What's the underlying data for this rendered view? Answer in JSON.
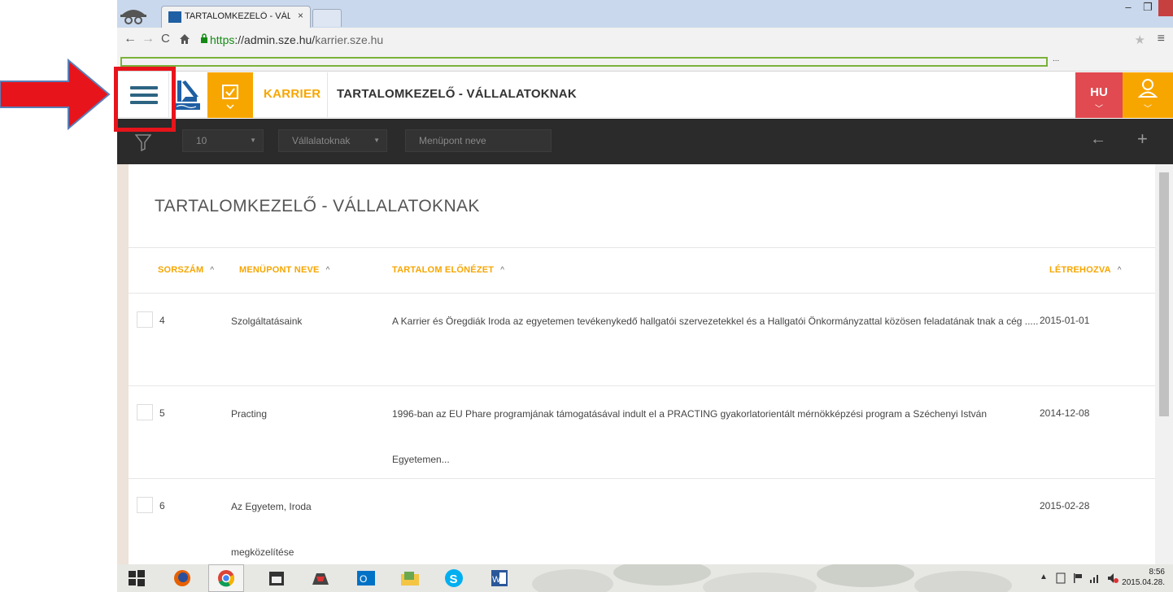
{
  "browser": {
    "tab_title": "TARTALOMKEZELŐ - VÁLL",
    "tab_close": "×",
    "window": {
      "minimize": "–",
      "maximize": "❐",
      "close": "✕"
    },
    "url_scheme": "https",
    "url_rest": "://admin.sze.hu/",
    "url_path": "karrier.sze.hu",
    "bookmarks_more": "..."
  },
  "app": {
    "name": "KARRIER",
    "page_heading": "TARTALOMKEZELŐ - VÁLLALATOKNAK",
    "language": "HU"
  },
  "filters": {
    "count_value": "10",
    "category_value": "Vállalatoknak",
    "name_placeholder": "Menüpont neve"
  },
  "main": {
    "title": "TARTALOMKEZELŐ - VÁLLALATOKNAK",
    "columns": {
      "number": "SORSZÁM",
      "menu_name": "MENÜPONT NEVE",
      "preview": "TARTALOM ELŐNÉZET",
      "created": "LÉTREHOZVA"
    },
    "sort_glyph": "^",
    "rows": [
      {
        "number": "4",
        "menu_name": "Szolgáltatásaink",
        "preview": "A Karrier és Öregdiák Iroda az egyetemen tevékenykedő hallgatói szervezetekkel és a Hallgatói Önkormányzattal közösen feladatának tnak a cég .....",
        "created": "2015-01-01"
      },
      {
        "number": "5",
        "menu_name": "Practing",
        "preview": "1996-ban az EU Phare programjának támogatásával indult el a PRACTING gyakorlatorientált mérnökképzési program a Széchenyi István Egyetemen...",
        "created": "2014-12-08"
      },
      {
        "number": "6",
        "menu_name": "Az Egyetem, Iroda megközelítése",
        "preview": "",
        "created": "2015-02-28"
      }
    ]
  },
  "taskbar": {
    "time": "8:56",
    "date": "2015.04.28."
  },
  "colors": {
    "accent_orange": "#f7a600",
    "accent_red": "#e04a50",
    "filterbar": "#2b2b2b",
    "annotation": "#e8141b"
  }
}
